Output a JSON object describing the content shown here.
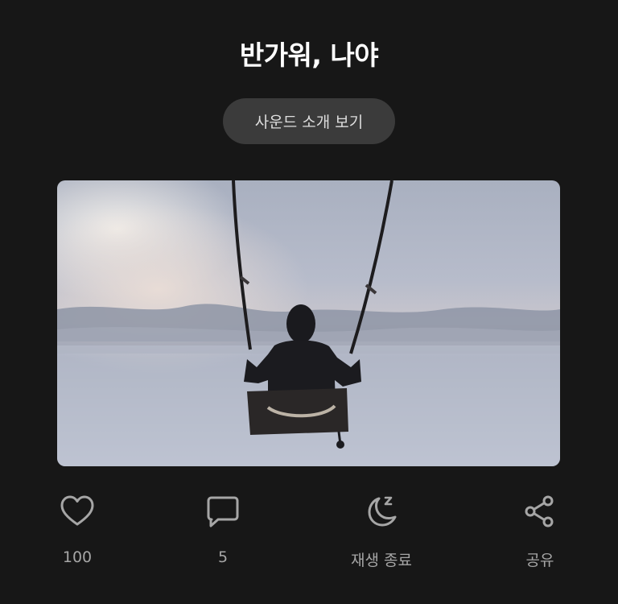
{
  "header": {
    "title": "반가워, 나야"
  },
  "intro_button": {
    "label": "사운드 소개 보기"
  },
  "actions": {
    "like": {
      "count": "100",
      "icon": "heart-icon"
    },
    "comment": {
      "count": "5",
      "icon": "comment-bubble-icon"
    },
    "sleep_timer": {
      "label": "재생 종료",
      "icon": "moon-sleep-icon"
    },
    "share": {
      "label": "공유",
      "icon": "share-icon"
    }
  },
  "colors": {
    "background": "#171717",
    "button_bg": "#3b3b3b",
    "icon": "#a6a6a6"
  }
}
